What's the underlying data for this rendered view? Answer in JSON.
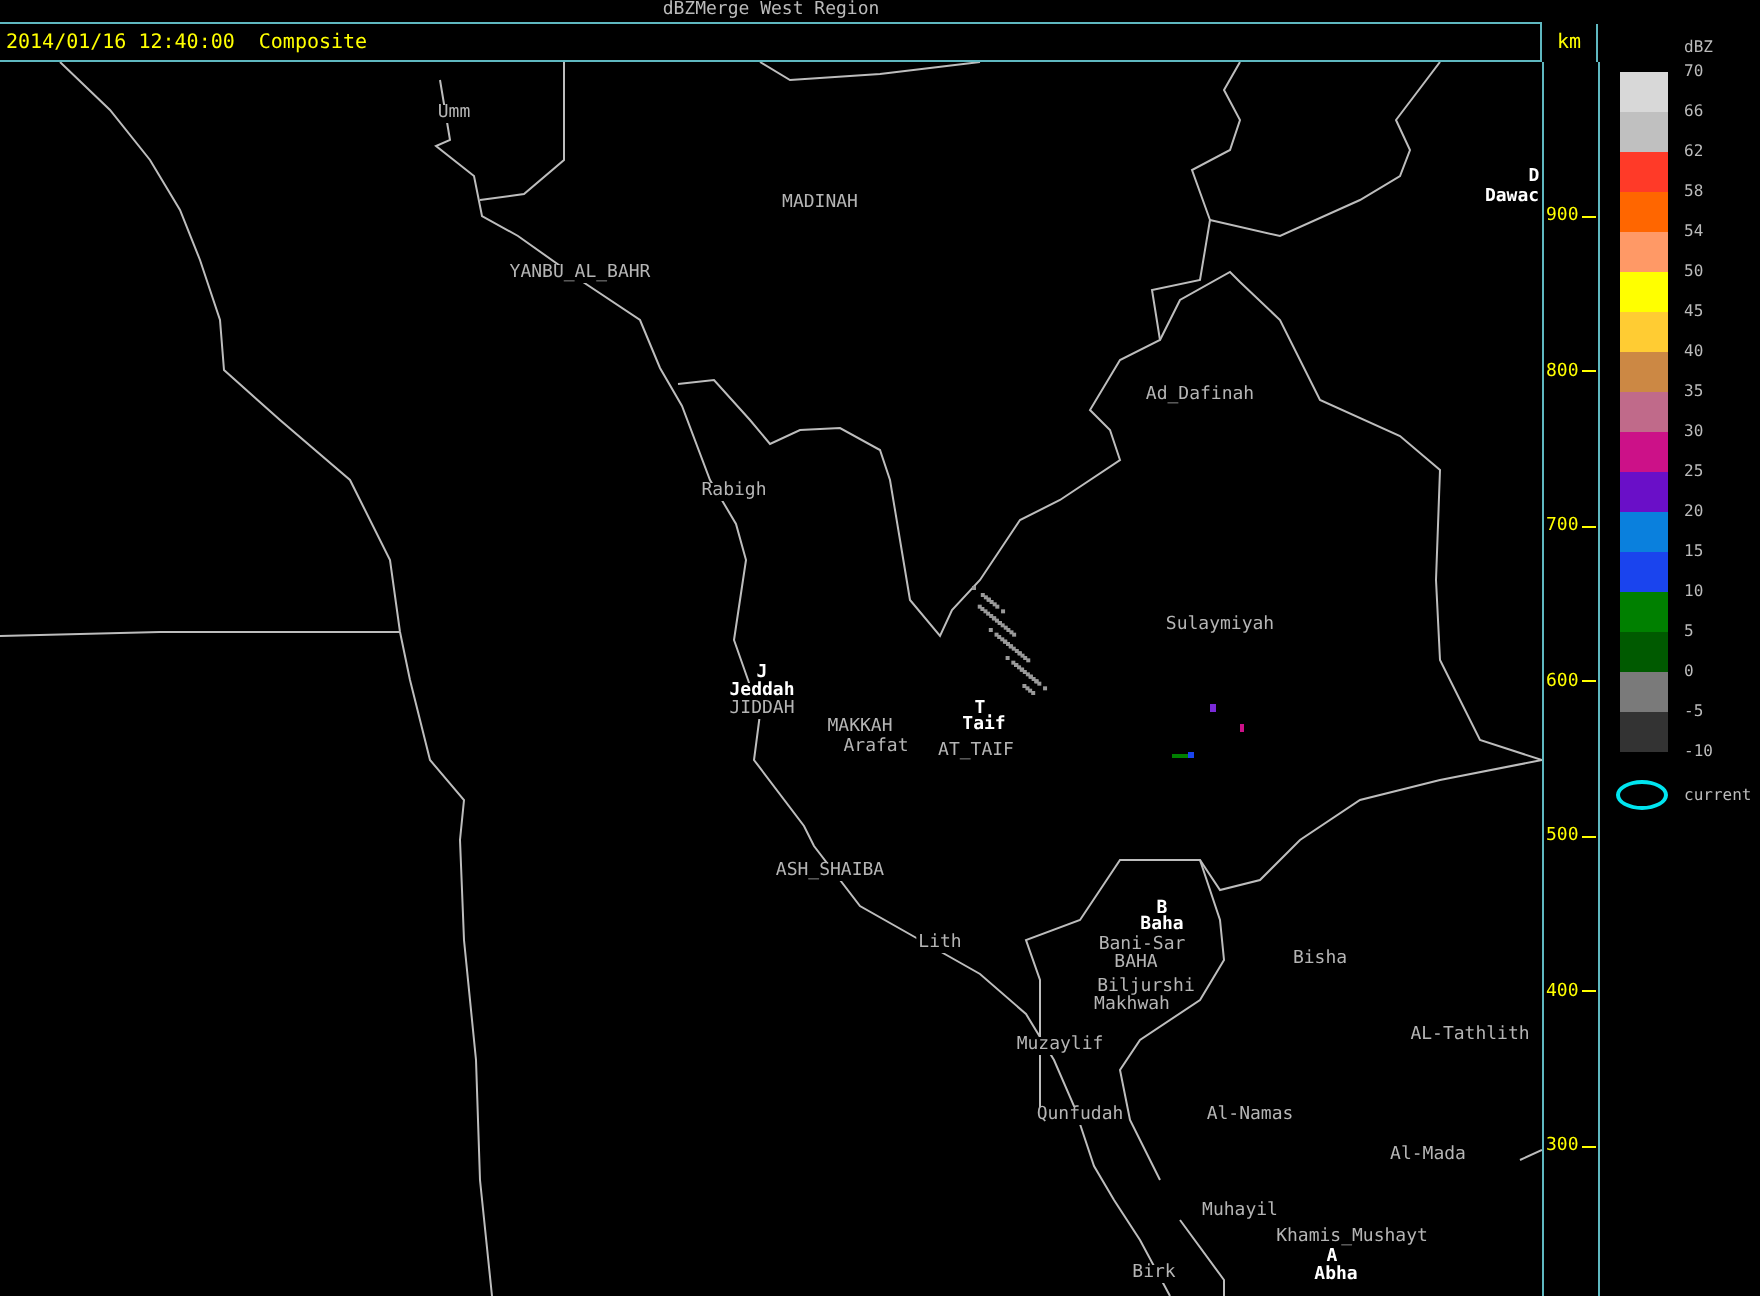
{
  "title": "dBZMerge West Region",
  "timestamp": "2014/01/16 12:40:00",
  "product": "Composite",
  "axis": {
    "unit": "km",
    "ticks": [
      "900",
      "800",
      "700",
      "600",
      "500",
      "400",
      "300"
    ]
  },
  "map_labels": [
    {
      "text": "Umm",
      "kind": "city"
    },
    {
      "text": "MADINAH",
      "kind": "city"
    },
    {
      "text": "YANBU_AL_BAHR",
      "kind": "city"
    },
    {
      "text": "D",
      "kind": "site"
    },
    {
      "text": "Dawac",
      "kind": "site"
    },
    {
      "text": "Ad_Dafinah",
      "kind": "city"
    },
    {
      "text": "Rabigh",
      "kind": "city"
    },
    {
      "text": "Sulaymiyah",
      "kind": "city"
    },
    {
      "text": "J",
      "kind": "site"
    },
    {
      "text": "Jeddah",
      "kind": "site"
    },
    {
      "text": "JIDDAH",
      "kind": "city"
    },
    {
      "text": "T",
      "kind": "site"
    },
    {
      "text": "Taif",
      "kind": "site"
    },
    {
      "text": "MAKKAH",
      "kind": "city"
    },
    {
      "text": "Arafat",
      "kind": "city"
    },
    {
      "text": "AT_TAIF",
      "kind": "city"
    },
    {
      "text": "ASH_SHAIBA",
      "kind": "city"
    },
    {
      "text": "B",
      "kind": "site"
    },
    {
      "text": "Baha",
      "kind": "site"
    },
    {
      "text": "Lith",
      "kind": "city"
    },
    {
      "text": "Bani-Sar",
      "kind": "city"
    },
    {
      "text": "BAHA",
      "kind": "city"
    },
    {
      "text": "Bisha",
      "kind": "city"
    },
    {
      "text": "Biljurshi",
      "kind": "city"
    },
    {
      "text": "Makhwah",
      "kind": "city"
    },
    {
      "text": "Muzaylif",
      "kind": "city"
    },
    {
      "text": "AL-Tathlith",
      "kind": "city"
    },
    {
      "text": "Qunfudah",
      "kind": "city"
    },
    {
      "text": "Al-Namas",
      "kind": "city"
    },
    {
      "text": "Al-Mada",
      "kind": "city"
    },
    {
      "text": "Muhayil",
      "kind": "city"
    },
    {
      "text": "Khamis_Mushayt",
      "kind": "city"
    },
    {
      "text": "A",
      "kind": "site"
    },
    {
      "text": "Abha",
      "kind": "site"
    },
    {
      "text": "Birk",
      "kind": "city"
    }
  ],
  "legend": {
    "unit": "dBZ",
    "bins": [
      {
        "label": "70",
        "color": "#d8d8d8"
      },
      {
        "label": "66",
        "color": "#c0c0c0"
      },
      {
        "label": "62",
        "color": "#ff3a28"
      },
      {
        "label": "58",
        "color": "#ff6600"
      },
      {
        "label": "54",
        "color": "#ff9966"
      },
      {
        "label": "50",
        "color": "#ffff00"
      },
      {
        "label": "45",
        "color": "#ffcc33"
      },
      {
        "label": "40",
        "color": "#cc8844"
      },
      {
        "label": "35",
        "color": "#c06a8a"
      },
      {
        "label": "30",
        "color": "#cc1188"
      },
      {
        "label": "25",
        "color": "#6a0fc8"
      },
      {
        "label": "20",
        "color": "#0a80dd"
      },
      {
        "label": "15",
        "color": "#1a44ee"
      },
      {
        "label": "10",
        "color": "#008000"
      },
      {
        "label": "5",
        "color": "#005a00"
      },
      {
        "label": "0",
        "color": "#7a7a7a"
      },
      {
        "label": "-5",
        "color": "#333333"
      }
    ],
    "bottom_label": "-10",
    "marker_label": "current"
  }
}
